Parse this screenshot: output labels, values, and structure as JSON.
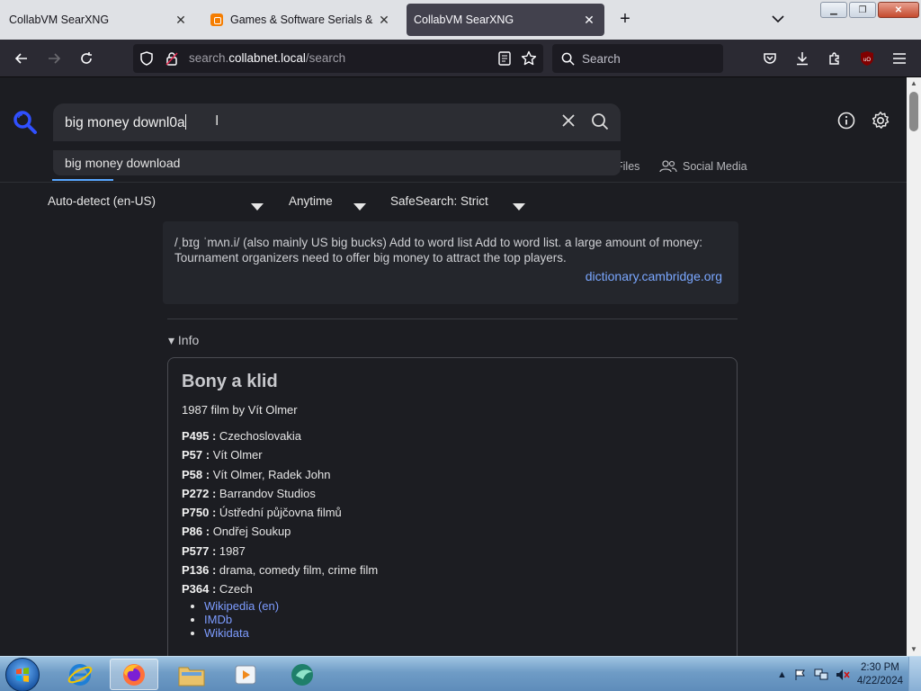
{
  "browser": {
    "tabs": [
      {
        "title": "CollabVM SearXNG",
        "active": false
      },
      {
        "title": "Games & Software Serials & Lic",
        "active": false
      },
      {
        "title": "CollabVM SearXNG",
        "active": true
      }
    ],
    "url_prefix": "search.",
    "url_domain": "collabnet.local",
    "url_path": "/search",
    "search_placeholder": "Search"
  },
  "searxng": {
    "query": "big money downl0a",
    "autocomplete": [
      "big money download"
    ],
    "categories": [
      {
        "label": "Files",
        "icon": "files-icon"
      },
      {
        "label": "Social Media",
        "icon": "people-icon"
      }
    ],
    "filters": {
      "language": "Auto-detect (en-US)",
      "time_range": "Anytime",
      "safesearch": "SafeSearch: Strict"
    },
    "answer": {
      "text": "/ˌbɪɡ ˈmʌn.i/ (also mainly US big bucks) Add to word list Add to word list. a large amount of money: Tournament organizers need to offer big money to attract the top players.",
      "source": "dictionary.cambridge.org"
    },
    "info_label": "Info",
    "infobox": {
      "title": "Bony a klid",
      "subtitle": "1987 film by Vít Olmer",
      "attributes": [
        {
          "key": "P495 :",
          "value": " Czechoslovakia"
        },
        {
          "key": "P57 :",
          "value": " Vít Olmer"
        },
        {
          "key": "P58 :",
          "value": " Vít Olmer, Radek John"
        },
        {
          "key": "P272 :",
          "value": " Barrandov Studios"
        },
        {
          "key": "P750 :",
          "value": " Ústřední půjčovna filmů"
        },
        {
          "key": "P86 :",
          "value": " Ondřej Soukup"
        },
        {
          "key": "P577 :",
          "value": " 1987"
        },
        {
          "key": "P136 :",
          "value": " drama, comedy film, crime film"
        },
        {
          "key": "P364 :",
          "value": " Czech"
        }
      ],
      "links": [
        "Wikipedia (en)",
        "IMDb",
        "Wikidata"
      ]
    }
  },
  "taskbar": {
    "time": "2:30 PM",
    "date": "4/22/2024",
    "apps": [
      "start-orb",
      "internet-explorer",
      "firefox",
      "file-explorer",
      "media-player",
      "collabvm"
    ]
  },
  "colors": {
    "accent": "#58a6ff",
    "link": "#7d9cff",
    "logo": "#3050ff"
  }
}
